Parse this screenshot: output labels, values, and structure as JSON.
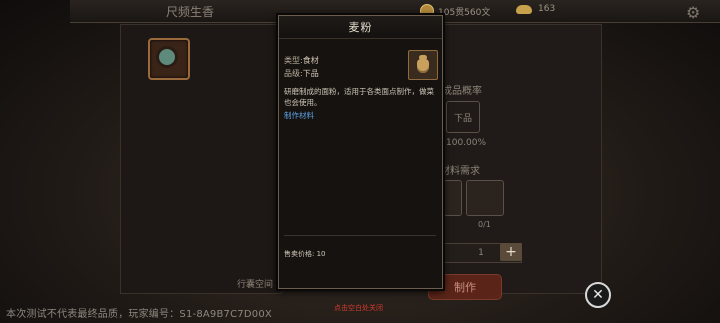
{
  "topbar": {
    "title": "尺频生香",
    "coins": "105贯560文",
    "ingots": "163"
  },
  "dialog": {
    "title": "麦粉",
    "type_label": "类型:",
    "type_value": "食材",
    "grade_label": "品级:",
    "grade_value": "下品",
    "description": "研磨制成的面粉，适用于各类面点制作，做菜也会使用。",
    "tag": "制作材料",
    "price_label": "售卖价格:",
    "price_value": "10"
  },
  "craft_panel": {
    "rate_label": "成品概率",
    "rate_grade": "下品",
    "rate_value": "100.00%",
    "req_label": "材料需求",
    "req_count": "0/1",
    "quantity": "1",
    "craft_button": "制作",
    "bag_label": "行囊空间"
  },
  "footer": {
    "note": "本次测试不代表最终品质，玩家编号：S1-8A9B7C7D00X",
    "close_hint": "点击空白处关闭"
  },
  "colors": {
    "link_blue": "#5ea4e6",
    "close_hint_red": "#d23a2e"
  }
}
